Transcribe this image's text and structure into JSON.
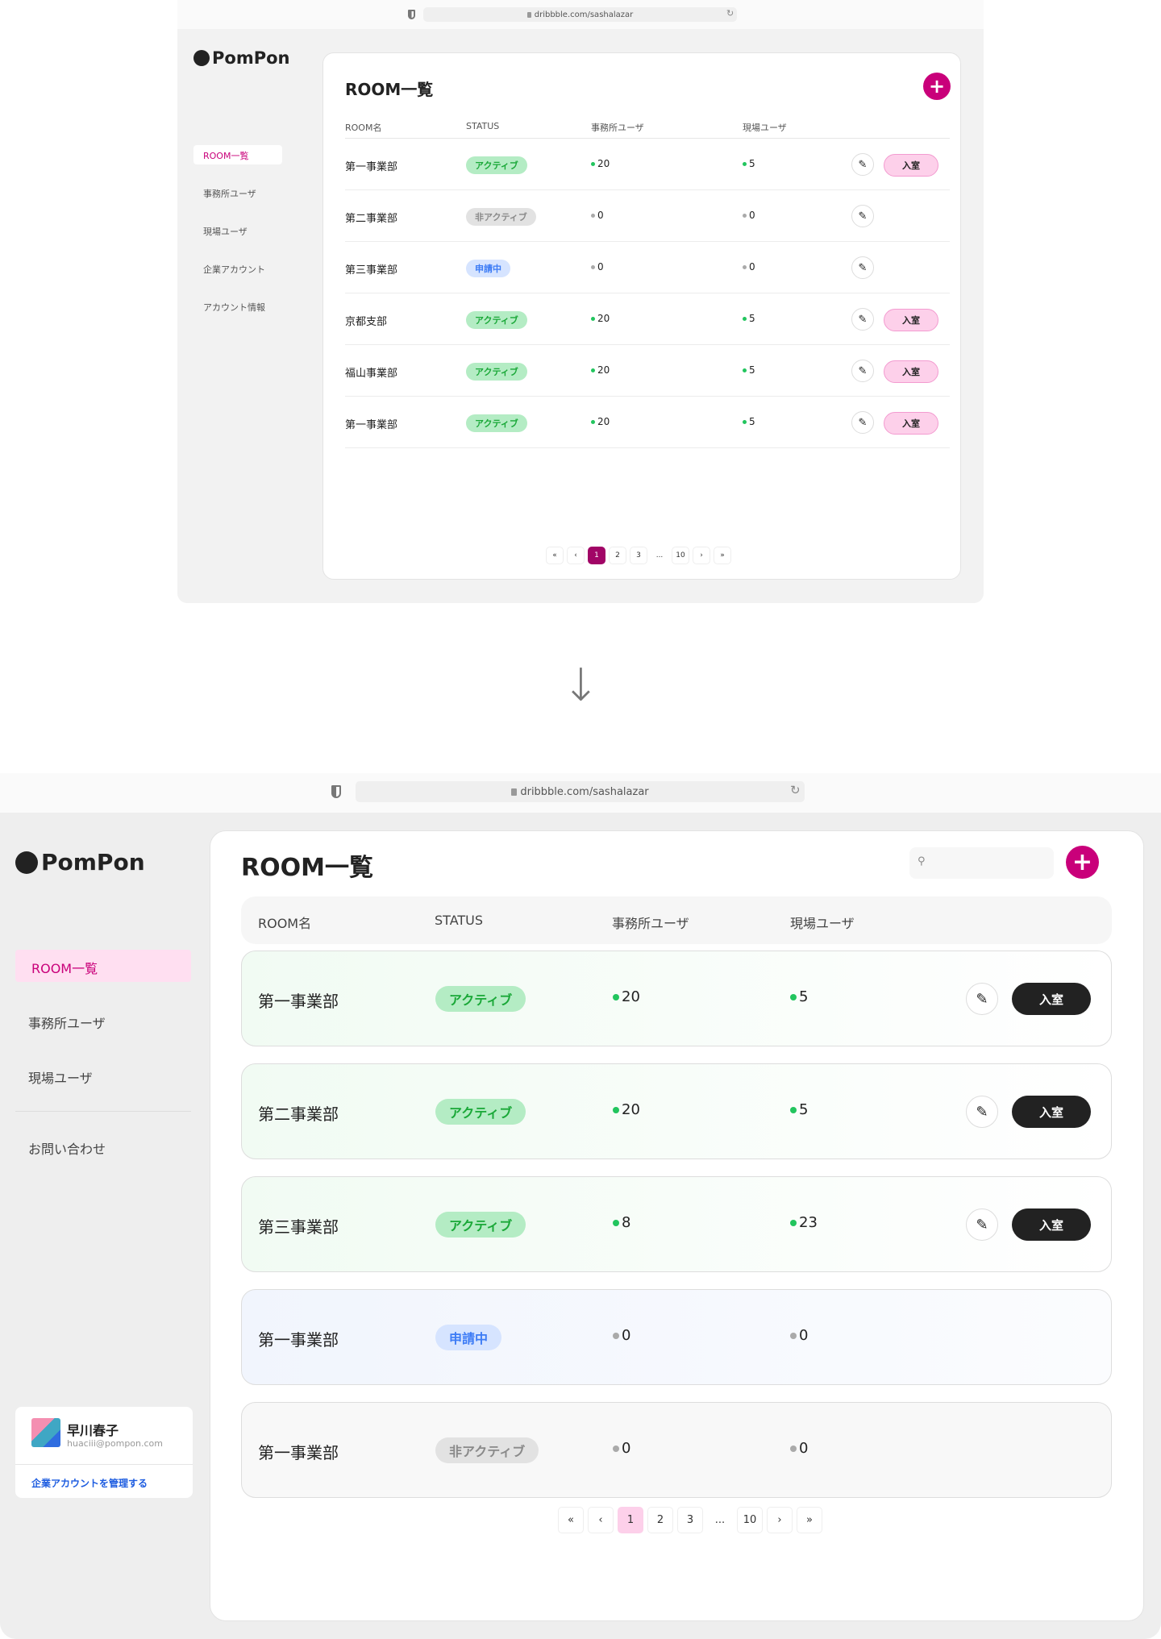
{
  "colors": {
    "accent": "#c9007a",
    "accent_light": "#ffdff1",
    "active": "#1aa838",
    "pending": "#3d7cf5",
    "inactive": "#8a8a8a",
    "enter_dark": "#222222"
  },
  "before": {
    "browser": {
      "url": "dribbble.com/sashalazar"
    },
    "logo": "PomPon",
    "sidebar": {
      "items": [
        {
          "label": "ROOM一覧",
          "active": true
        },
        {
          "label": "事務所ユーザ"
        },
        {
          "label": "現場ユーザ"
        },
        {
          "label": "企業アカウント"
        },
        {
          "label": "アカウント情報"
        }
      ]
    },
    "title": "ROOM一覧",
    "add_icon": "plus-icon",
    "columns": [
      "ROOM名",
      "STATUS",
      "事務所ユーザ",
      "現場ユーザ"
    ],
    "rows": [
      {
        "name": "第一事業部",
        "status": "アクティブ",
        "kind": "active",
        "office": "20",
        "site": "5",
        "enter": "入室"
      },
      {
        "name": "第二事業部",
        "status": "非アクティブ",
        "kind": "inactive",
        "office": "0",
        "site": "0"
      },
      {
        "name": "第三事業部",
        "status": "申請中",
        "kind": "pending",
        "office": "0",
        "site": "0"
      },
      {
        "name": "京都支部",
        "status": "アクティブ",
        "kind": "active",
        "office": "20",
        "site": "5",
        "enter": "入室"
      },
      {
        "name": "福山事業部",
        "status": "アクティブ",
        "kind": "active",
        "office": "20",
        "site": "5",
        "enter": "入室"
      },
      {
        "name": "第一事業部",
        "status": "アクティブ",
        "kind": "active",
        "office": "20",
        "site": "5",
        "enter": "入室"
      }
    ],
    "pagination": [
      "«",
      "‹",
      "1",
      "2",
      "3",
      "...",
      "10",
      "›",
      "»"
    ],
    "current_page": "1"
  },
  "arrow": "↓",
  "after": {
    "browser": {
      "url": "dribbble.com/sashalazar"
    },
    "logo": "PomPon",
    "sidebar": {
      "items": [
        {
          "label": "ROOM一覧",
          "active": true
        },
        {
          "label": "事務所ユーザ"
        },
        {
          "label": "現場ユーザ"
        }
      ],
      "contact": "お問い合わせ"
    },
    "user": {
      "name": "早川春子",
      "email": "huaciii@pompon.com",
      "manage_link": "企業アカウントを管理する"
    },
    "title": "ROOM一覧",
    "search": {
      "placeholder": ""
    },
    "columns": [
      "ROOM名",
      "STATUS",
      "事務所ユーザ",
      "現場ユーザ"
    ],
    "rows": [
      {
        "name": "第一事業部",
        "status": "アクティブ",
        "kind": "active",
        "office": "20",
        "site": "5",
        "enter": "入室"
      },
      {
        "name": "第二事業部",
        "status": "アクティブ",
        "kind": "active",
        "office": "20",
        "site": "5",
        "enter": "入室"
      },
      {
        "name": "第三事業部",
        "status": "アクティブ",
        "kind": "active",
        "office": "8",
        "site": "23",
        "enter": "入室"
      },
      {
        "name": "第一事業部",
        "status": "申請中",
        "kind": "pending",
        "office": "0",
        "site": "0"
      },
      {
        "name": "第一事業部",
        "status": "非アクティブ",
        "kind": "inactive",
        "office": "0",
        "site": "0"
      }
    ],
    "pagination": [
      "«",
      "‹",
      "1",
      "2",
      "3",
      "...",
      "10",
      "›",
      "»"
    ],
    "current_page": "1"
  }
}
